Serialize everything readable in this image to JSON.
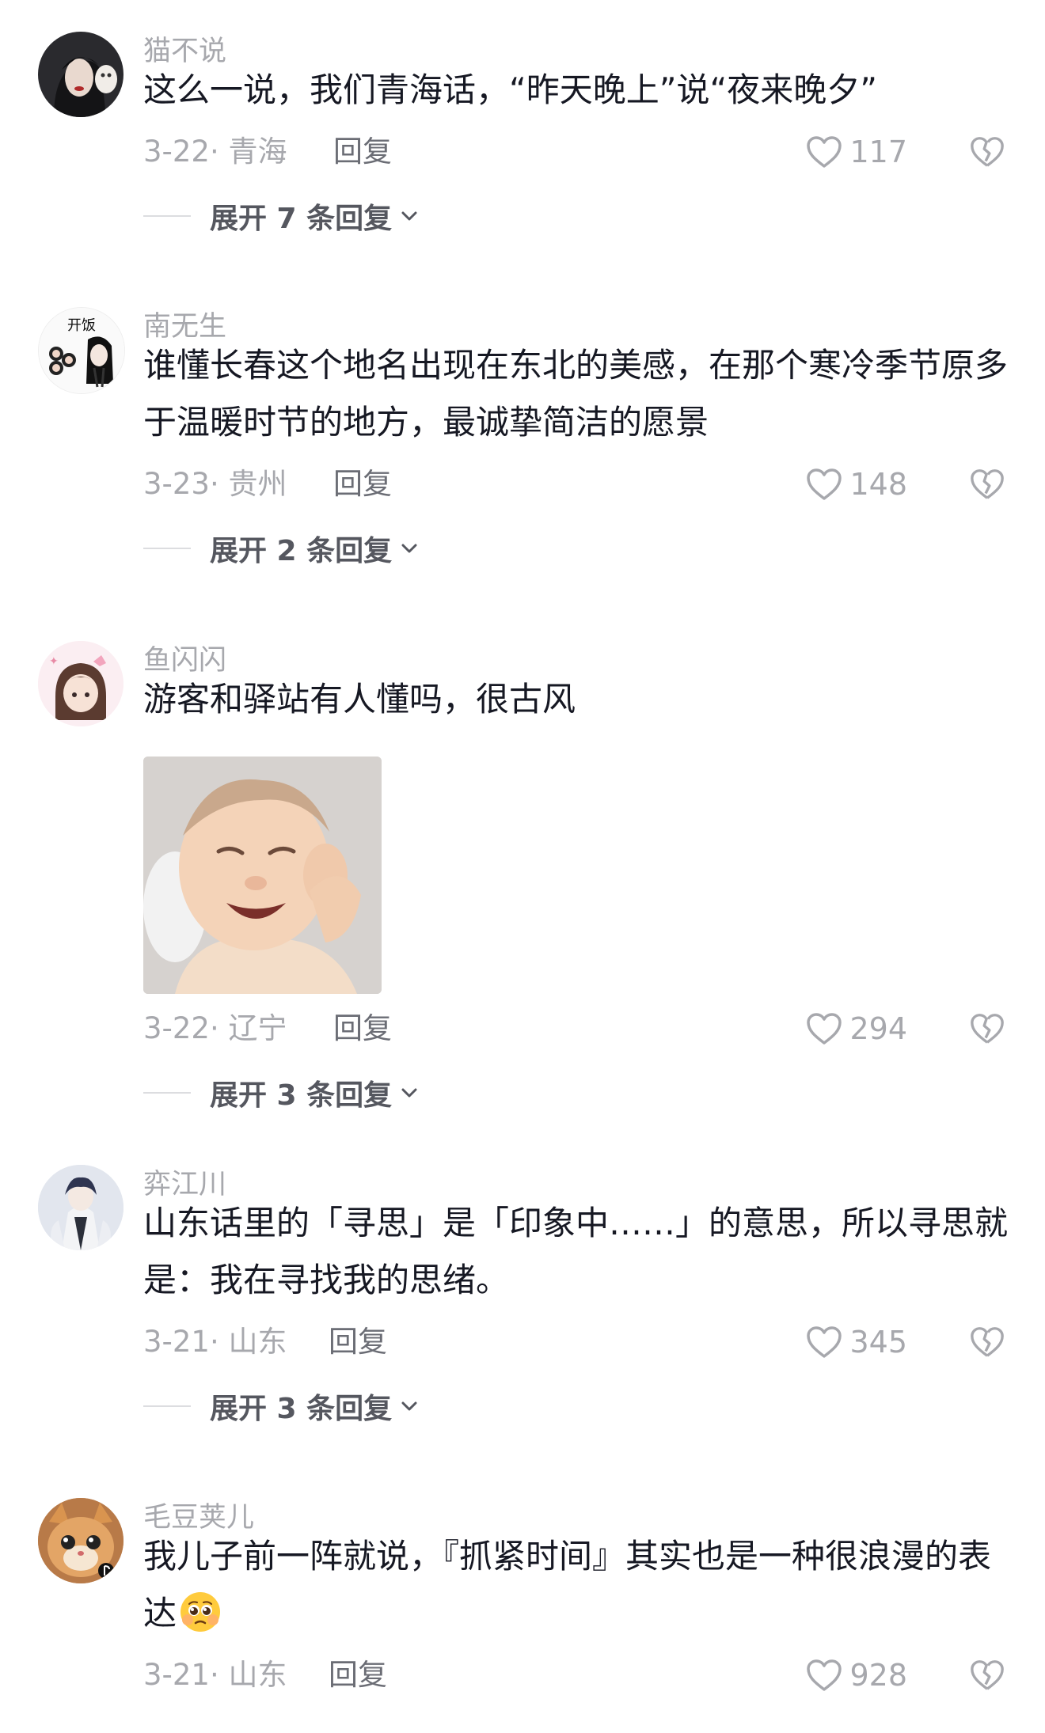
{
  "comments": [
    {
      "user": "猫不说",
      "text": "这么一说，我们青海话，“昨天晚上”说“夜来晚夕”",
      "date_location": "3-22· 青海",
      "reply_label": "回复",
      "likes": "117",
      "expand_label": "展开 7 条回复"
    },
    {
      "user": "南无生",
      "text": "谁懂长春这个地名出现在东北的美感，在那个寒冷季节原多于温暖时节的地方，最诚挚简洁的愿景",
      "date_location": "3-23· 贵州",
      "reply_label": "回复",
      "likes": "148",
      "expand_label": "展开 2 条回复",
      "avatar_text": "开饭"
    },
    {
      "user": "鱼闪闪",
      "text": "游客和驿站有人懂吗，很古风",
      "date_location": "3-22· 辽宁",
      "reply_label": "回复",
      "likes": "294",
      "expand_label": "展开 3 条回复"
    },
    {
      "user": "弈江川",
      "text": "山东话里的「寻思」是「印象中……」的意思，所以寻思就是：我在寻找我的思绪。",
      "date_location": "3-21· 山东",
      "reply_label": "回复",
      "likes": "345",
      "expand_label": "展开 3 条回复"
    },
    {
      "user": "毛豆荚儿",
      "text": "我儿子前一阵就说，『抓紧时间』其实也是一种很浪漫的表达",
      "date_location": "3-21· 山东",
      "reply_label": "回复",
      "likes": "928"
    }
  ],
  "colors": {
    "text_primary": "#161823",
    "text_secondary": "#a7a8ad",
    "reply_link": "#6b6d75",
    "expand_text": "#55575f"
  },
  "icons": [
    "heart-outline-icon",
    "broken-heart-icon",
    "chevron-down-icon",
    "pleading-face-emoji"
  ]
}
